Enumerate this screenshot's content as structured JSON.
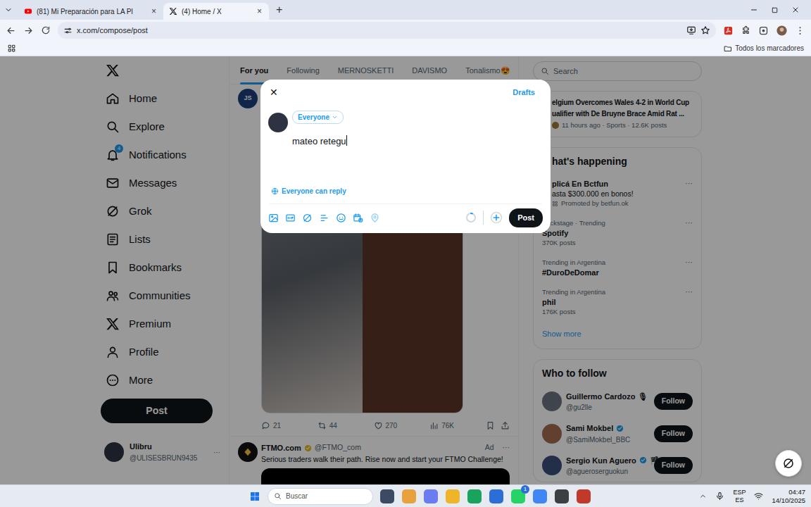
{
  "browser": {
    "tabs": [
      {
        "label": "(81) Mi Preparación para LA Pl",
        "selected": false,
        "close": "×"
      },
      {
        "label": "(4) Home / X",
        "selected": true,
        "close": "×"
      }
    ],
    "new_tab": "+",
    "address": "x.com/compose/post",
    "bookmarks": "Todos los marcadores"
  },
  "nav": {
    "items": [
      {
        "label": "Home"
      },
      {
        "label": "Explore"
      },
      {
        "label": "Notifications",
        "badge": "4"
      },
      {
        "label": "Messages"
      },
      {
        "label": "Grok"
      },
      {
        "label": "Lists"
      },
      {
        "label": "Bookmarks"
      },
      {
        "label": "Communities"
      },
      {
        "label": "Premium"
      },
      {
        "label": "Profile"
      },
      {
        "label": "More"
      }
    ],
    "post": "Post",
    "user": {
      "name": "Ulibru",
      "handle": "@ULISESBRUN9435",
      "more": "···"
    }
  },
  "feed": {
    "tabs": [
      {
        "label": "For you",
        "selected": true
      },
      {
        "label": "Following",
        "selected": false
      },
      {
        "label": "MERNOSKETTI",
        "selected": false
      },
      {
        "label": "DAVISMO",
        "selected": false
      },
      {
        "label": "Tonalismo😍",
        "selected": false
      }
    ],
    "tweet": {
      "avatar": "JS",
      "replies": "21",
      "reposts": "44",
      "likes": "270",
      "views": "76K"
    },
    "ad": {
      "name": "FTMO.com",
      "handle": "@FTMO_com",
      "label": "Ad",
      "more": "···",
      "text": "Serious traders walk their path. Rise now and start your FTMO Challenge!"
    }
  },
  "sidebar": {
    "search": {
      "placeholder": "Search"
    },
    "news": {
      "title": [
        "elgium Overcomes Wales 4-2 in World Cup",
        "ualifier with De Bruyne Brace Amid Rat ..."
      ],
      "meta": "11 hours ago · Sports · 12.6K posts"
    },
    "happening": {
      "title": "hat's happening",
      "items": [
        {
          "kind": "promo",
          "title": "plicá En Bctfun",
          "line": "asta $300.000 en bonos!",
          "meta": "Promoted by betfun.ok",
          "more": "···"
        },
        {
          "kind": "trend",
          "context": "Backstage · Trending",
          "title": "Spotify",
          "meta": "370K posts",
          "more": "···"
        },
        {
          "kind": "trend",
          "context": "Trending in Argentina",
          "title": "#DuroDeDomar",
          "more": "···"
        },
        {
          "kind": "trend",
          "context": "Trending in Argentina",
          "title": "phil",
          "meta": "176K posts",
          "more": "···"
        }
      ],
      "show_more": "Show more"
    },
    "who_to_follow": {
      "title": "Who to follow",
      "items": [
        {
          "name": "Guillermo Cardozo",
          "extra": "🎙",
          "verified": false,
          "handle": "@gu2lle",
          "action": "Follow"
        },
        {
          "name": "Sami Mokbel",
          "verified": true,
          "handle": "@SamiMokbel_BBC",
          "action": "Follow"
        },
        {
          "name": "Sergio Kun Aguero",
          "extra": "🏴",
          "verified": true,
          "handle": "@agueroserguokun",
          "action": "Follow"
        }
      ]
    }
  },
  "composer": {
    "close": "✕",
    "drafts": "Drafts",
    "audience": "Everyone",
    "text": "mateo retegu",
    "reply_setting": "Everyone can reply",
    "post": "Post"
  },
  "taskbar": {
    "search": "Buscar",
    "badge": "1",
    "lang": [
      "ESP",
      "ES"
    ],
    "time": "04:47",
    "date": "14/10/2025"
  }
}
